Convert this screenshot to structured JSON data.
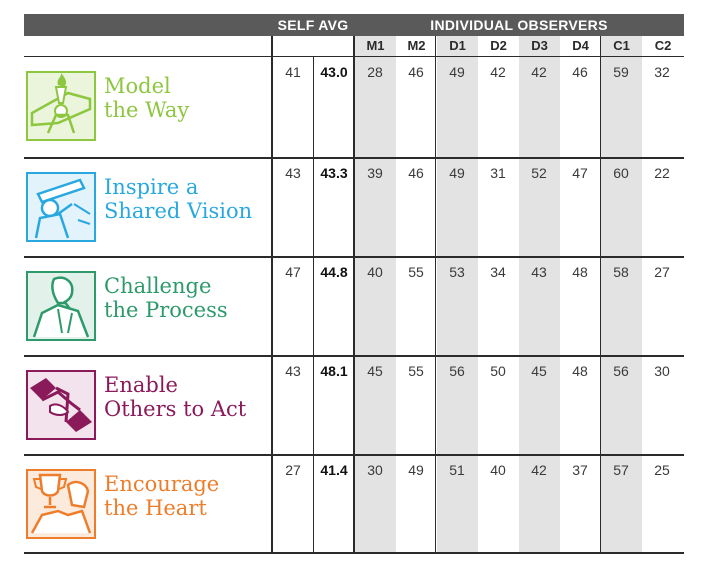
{
  "header": {
    "self_avg_label": "SELF AVG",
    "observers_label": "INDIVIDUAL OBSERVERS"
  },
  "columns": [
    "M1",
    "M2",
    "D1",
    "D2",
    "D3",
    "D4",
    "C1",
    "C2"
  ],
  "practices": [
    {
      "line1": "Model",
      "line2": "the Way",
      "color": "#8dc63f",
      "icon": "torch-icon",
      "self": "41",
      "avg": "43.0",
      "scores": [
        "28",
        "46",
        "49",
        "42",
        "42",
        "46",
        "59",
        "32"
      ]
    },
    {
      "line1": "Inspire a",
      "line2": "Shared Vision",
      "color": "#29a8e0",
      "icon": "telescope-icon",
      "self": "43",
      "avg": "43.3",
      "scores": [
        "39",
        "46",
        "49",
        "31",
        "52",
        "47",
        "60",
        "22"
      ]
    },
    {
      "line1": "Challenge",
      "line2": "the Process",
      "color": "#2e9a6b",
      "icon": "thinker-icon",
      "self": "47",
      "avg": "44.8",
      "scores": [
        "40",
        "55",
        "53",
        "34",
        "43",
        "48",
        "58",
        "27"
      ]
    },
    {
      "line1": "Enable",
      "line2": "Others to Act",
      "color": "#8b1a5a",
      "icon": "handshake-icon",
      "self": "43",
      "avg": "48.1",
      "scores": [
        "45",
        "55",
        "56",
        "50",
        "45",
        "48",
        "56",
        "30"
      ]
    },
    {
      "line1": "Encourage",
      "line2": "the Heart",
      "color": "#ee7d2b",
      "icon": "trophy-icon",
      "self": "27",
      "avg": "41.4",
      "scores": [
        "30",
        "49",
        "51",
        "40",
        "42",
        "37",
        "57",
        "25"
      ]
    }
  ]
}
